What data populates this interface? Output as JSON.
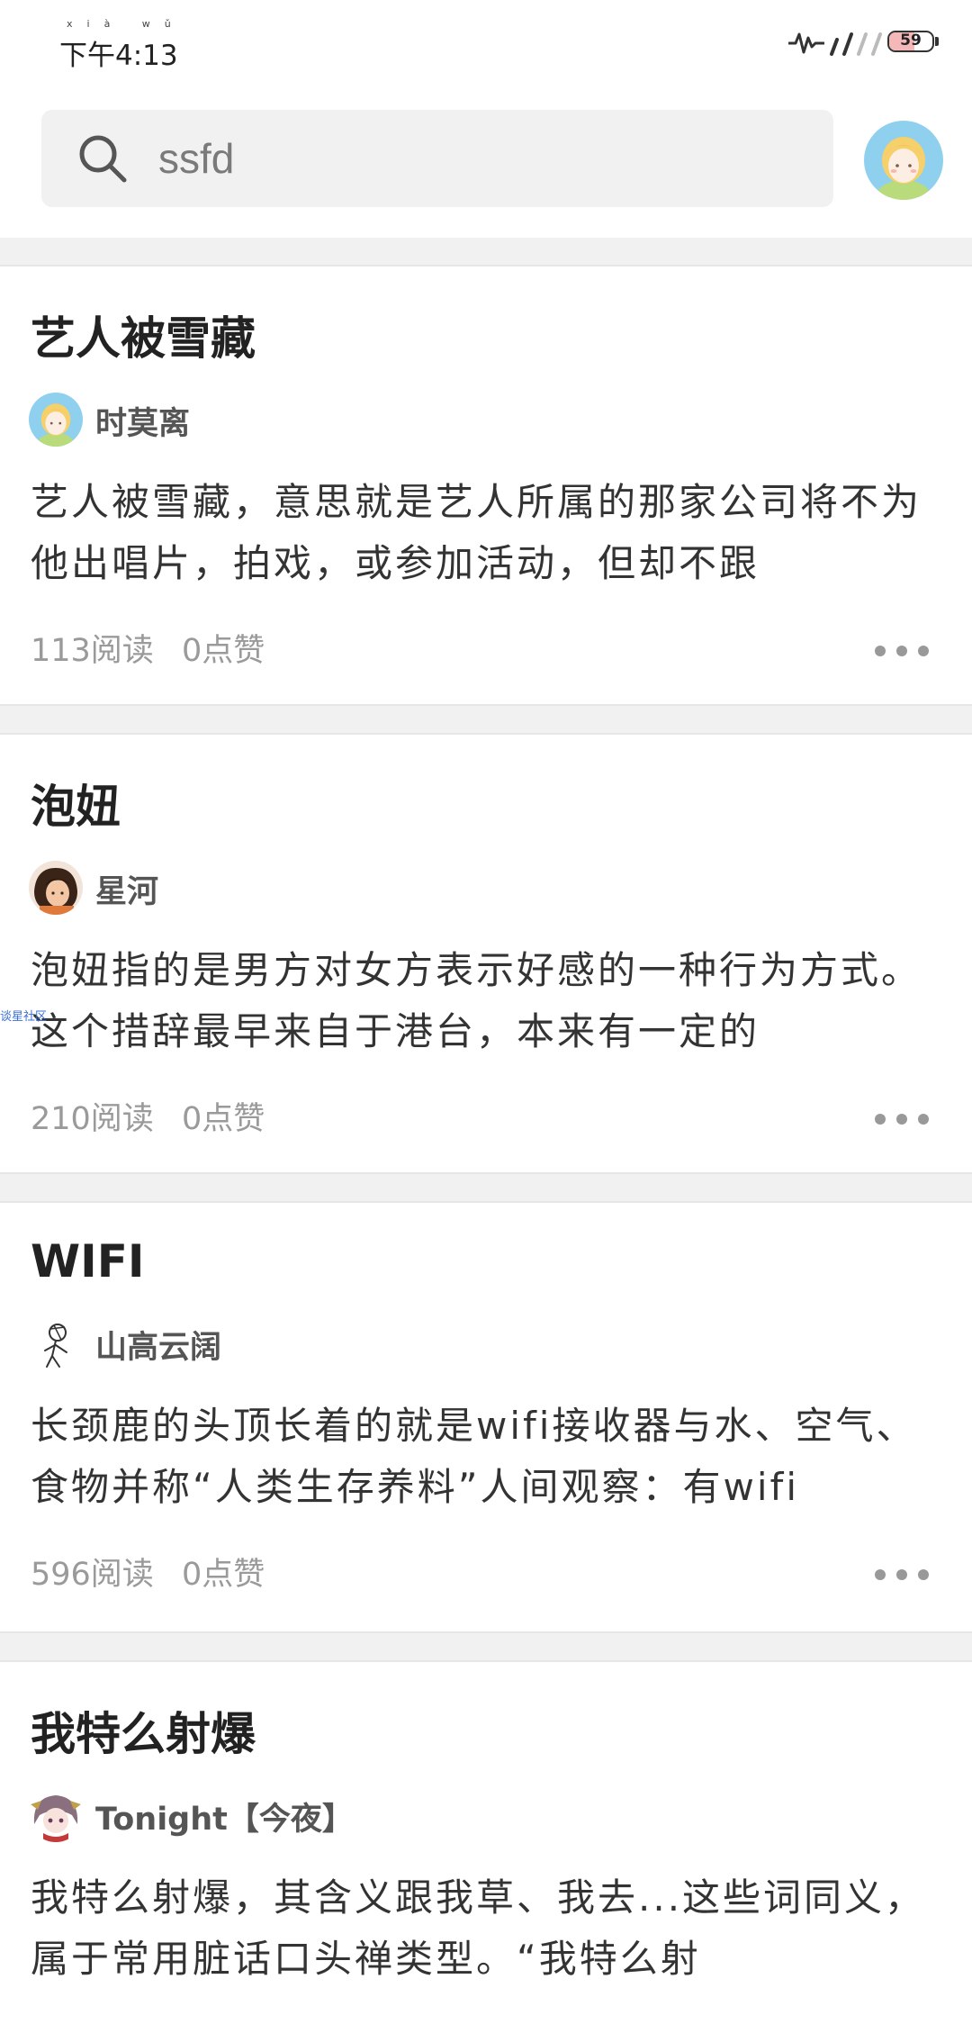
{
  "status_bar": {
    "ruby": "xià wǔ",
    "time": "下午4:13",
    "battery_level": "59",
    "battery_fraction": 0.59
  },
  "search": {
    "value": "ssfd",
    "placeholder": ""
  },
  "watermark": "谈星社区",
  "feed": [
    {
      "title": "艺人被雪藏",
      "author": "时莫离",
      "avatar": "blonde-girl",
      "excerpt": "艺人被雪藏，意思就是艺人所属的那家公司将不为他出唱片，拍戏，或参加活动，但却不跟",
      "reads": "113阅读",
      "likes": "0点赞"
    },
    {
      "title": "泡妞",
      "author": "星河",
      "avatar": "photo-girl",
      "excerpt": "泡妞指的是男方对女方表示好感的一种行为方式。这个措辞最早来自于港台，本来有一定的",
      "reads": "210阅读",
      "likes": "0点赞"
    },
    {
      "title": "WIFI",
      "author": "山高云阔",
      "avatar": "sketch-figure",
      "excerpt": "长颈鹿的头顶长着的就是wifi接收器与水、空气、食物并称“人类生存养料”人间观察：有wifi",
      "reads": "596阅读",
      "likes": "0点赞"
    },
    {
      "title": "我特么射爆",
      "author": "Tonight【今夜】",
      "avatar": "anime-girl",
      "excerpt": "我特么射爆，其含义跟我草、我去...这些词同义，属于常用脏话口头禅类型。“我特么射",
      "reads": "",
      "likes": ""
    }
  ]
}
